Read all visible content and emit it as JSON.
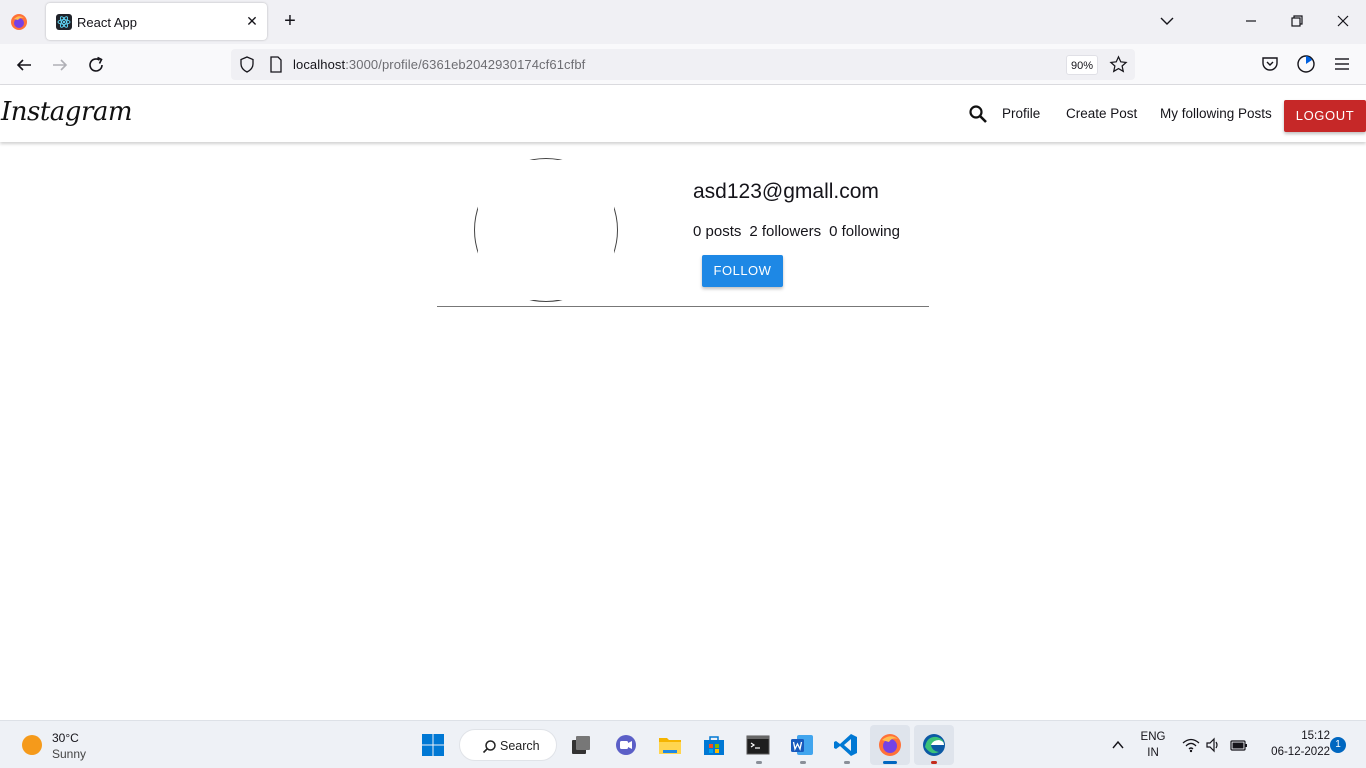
{
  "browser": {
    "tab_title": "React App",
    "url_host": "localhost",
    "url_rest": ":3000/profile/6361eb2042930174cf61cfbf",
    "zoom": "90%"
  },
  "app": {
    "brand": "Instagram",
    "nav": {
      "profile": "Profile",
      "create_post": "Create Post",
      "following_posts": "My following Posts",
      "logout": "LOGOUT"
    },
    "profile": {
      "email": "asd123@gmall.com",
      "posts": "0 posts",
      "followers": "2 followers",
      "following": "0 following",
      "follow_label": "FOLLOW"
    },
    "colors": {
      "logout_bg": "#c62828",
      "follow_bg": "#1e88e5"
    }
  },
  "taskbar": {
    "temperature": "30°C",
    "weather": "Sunny",
    "search_label": "Search",
    "lang_top": "ENG",
    "lang_bottom": "IN",
    "time": "15:12",
    "date": "06-12-2022",
    "notifications": "1"
  }
}
